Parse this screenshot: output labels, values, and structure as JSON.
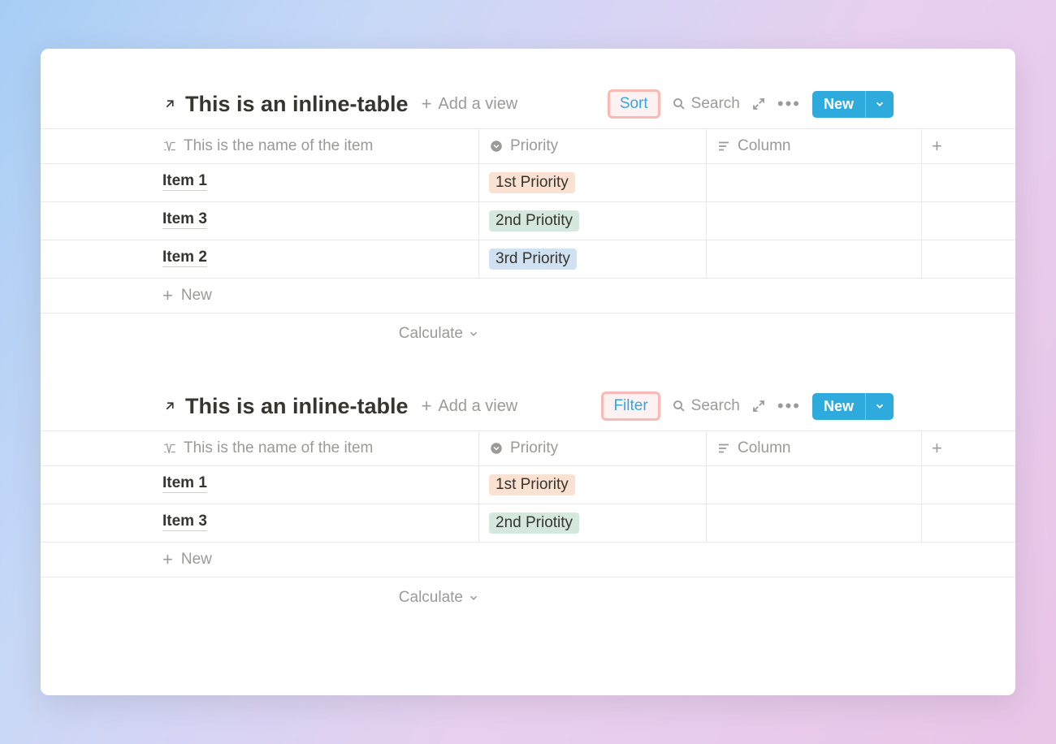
{
  "tables": [
    {
      "title": "This is an inline-table",
      "add_view_label": "Add a view",
      "action_label": "Sort",
      "search_label": "Search",
      "new_button_label": "New",
      "new_row_label": "New",
      "calculate_label": "Calculate",
      "columns": {
        "name": "This is the name of the item",
        "priority": "Priority",
        "column": "Column"
      },
      "rows": [
        {
          "name": "Item 1",
          "priority": "1st Priority",
          "priority_color": "orange"
        },
        {
          "name": "Item 3",
          "priority": "2nd Priotity",
          "priority_color": "green"
        },
        {
          "name": "Item 2",
          "priority": "3rd Priority",
          "priority_color": "blue"
        }
      ]
    },
    {
      "title": "This is an inline-table",
      "add_view_label": "Add a view",
      "action_label": "Filter",
      "search_label": "Search",
      "new_button_label": "New",
      "new_row_label": "New",
      "calculate_label": "Calculate",
      "columns": {
        "name": "This is the name of the item",
        "priority": "Priority",
        "column": "Column"
      },
      "rows": [
        {
          "name": "Item 1",
          "priority": "1st Priority",
          "priority_color": "orange"
        },
        {
          "name": "Item 3",
          "priority": "2nd Priotity",
          "priority_color": "green"
        }
      ]
    }
  ]
}
